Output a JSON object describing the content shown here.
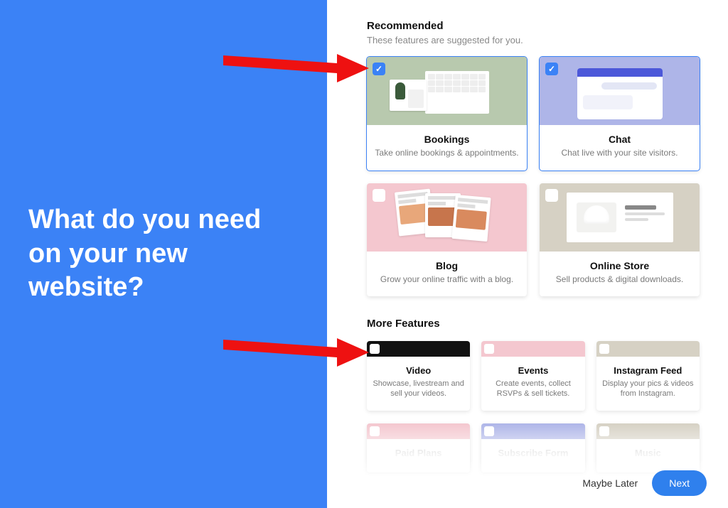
{
  "left": {
    "heading": "What do you need on your new website?"
  },
  "recommended": {
    "title": "Recommended",
    "subtitle": "These features are suggested for you.",
    "cards": [
      {
        "title": "Bookings",
        "desc": "Take online bookings & appointments.",
        "selected": true,
        "thumb_bg": "#B8C9AE"
      },
      {
        "title": "Chat",
        "desc": "Chat live with your site visitors.",
        "selected": true,
        "thumb_bg": "#AEB5E8"
      },
      {
        "title": "Blog",
        "desc": "Grow your online traffic with a blog.",
        "selected": false,
        "thumb_bg": "#F4C7CF"
      },
      {
        "title": "Online Store",
        "desc": "Sell products & digital downloads.",
        "selected": false,
        "thumb_bg": "#D6D1C4"
      }
    ]
  },
  "more": {
    "title": "More Features",
    "cards": [
      {
        "title": "Video",
        "desc": "Showcase, livestream and sell your videos.",
        "bar": "#111111"
      },
      {
        "title": "Events",
        "desc": "Create events, collect RSVPs & sell tickets.",
        "bar": "#F4C7CF"
      },
      {
        "title": "Instagram Feed",
        "desc": "Display your pics & videos from Instagram.",
        "bar": "#D6D1C4"
      },
      {
        "title": "Paid Plans",
        "desc": "",
        "bar": "#F4C7CF"
      },
      {
        "title": "Subscribe Form",
        "desc": "",
        "bar": "#AEB5E8"
      },
      {
        "title": "Music",
        "desc": "",
        "bar": "#D6D1C4"
      }
    ]
  },
  "footer": {
    "maybe": "Maybe Later",
    "next": "Next"
  },
  "annotations": {
    "arrows": [
      {
        "points_to": "recommended-card-bookings"
      },
      {
        "points_to": "more-card-video"
      }
    ]
  }
}
